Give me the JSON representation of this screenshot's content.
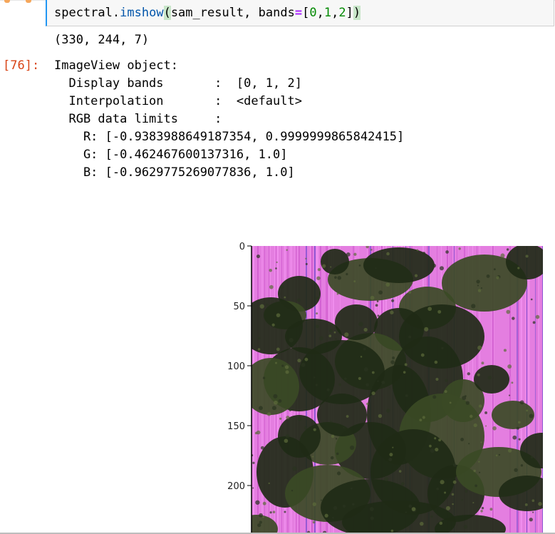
{
  "cell": {
    "code": {
      "obj": "spectral",
      "dot": ".",
      "func": "imshow",
      "open_paren": "(",
      "arg1": "sam_result, bands",
      "eq": "=",
      "list_open": "[",
      "n0": "0",
      "c1": ",",
      "n1": "1",
      "c2": ",",
      "n2": "2",
      "list_close": "]",
      "close_paren": ")"
    },
    "shape_output": "(330, 244, 7)",
    "out_prompt": "[76]:",
    "imageview": {
      "line1": "ImageView object:",
      "line2": "  Display bands       :  [0, 1, 2]",
      "line3": "  Interpolation       :  <default>",
      "line4": "  RGB data limits     :",
      "line5": "    R: [-0.9383988649187354, 0.9999999865842415]",
      "line6": "    G: [-0.462467600137316, 1.0]",
      "line7": "    B: [-0.9629775269077836, 1.0]"
    }
  },
  "plot": {
    "y_ticks": [
      "0",
      "50",
      "100",
      "150",
      "200"
    ],
    "y_tick_values": [
      0,
      50,
      100,
      150,
      200
    ],
    "colors": {
      "pink": "#e47ee0",
      "magenta": "#d05ccf",
      "dark": "#1f2a16",
      "moss": "#3b4a25",
      "axis": "#000000"
    }
  }
}
